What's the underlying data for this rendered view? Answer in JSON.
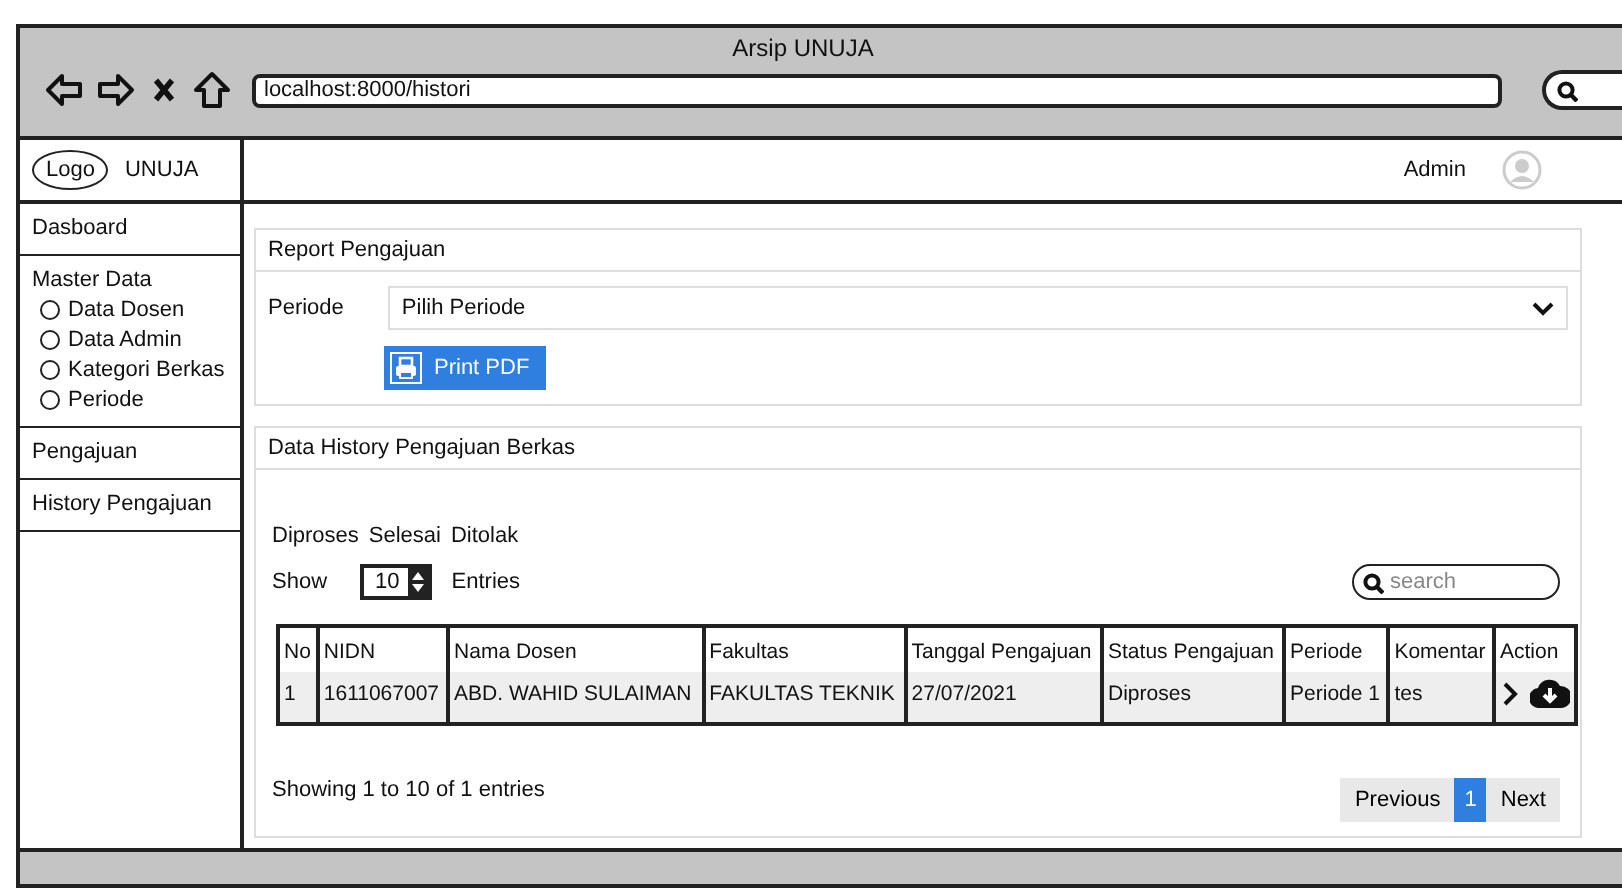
{
  "browser": {
    "title": "Arsip UNUJA",
    "url": "localhost:8000/histori"
  },
  "header": {
    "logo": "Logo",
    "brand": "UNUJA",
    "user": "Admin"
  },
  "sidebar": {
    "items": [
      {
        "label": "Dasboard"
      },
      {
        "label": "Master Data",
        "children": [
          {
            "label": "Data Dosen",
            "selected": false
          },
          {
            "label": "Data Admin",
            "selected": false
          },
          {
            "label": "Kategori Berkas",
            "selected": false
          },
          {
            "label": "Periode",
            "selected": false
          }
        ]
      },
      {
        "label": "Pengajuan"
      },
      {
        "label": "History Pengajuan"
      }
    ]
  },
  "report": {
    "title": "Report Pengajuan",
    "periode_label": "Periode",
    "periode_value": "Pilih Periode",
    "button": "Print PDF"
  },
  "history": {
    "title": "Data History Pengajuan Berkas",
    "filters": [
      "Diproses",
      "Selesai",
      "Ditolak"
    ],
    "show_label": "Show",
    "entries_value": "10",
    "entries_label": "Entries",
    "search": {
      "placeholder": "search"
    },
    "table": {
      "columns": [
        "No",
        "NIDN",
        "Nama Dosen",
        "Fakultas",
        "Tanggal Pengajuan",
        "Status Pengajuan",
        "Periode",
        "Komentar",
        "Action"
      ],
      "rows": [
        [
          "1",
          "1611067007",
          "ABD. WAHID SULAIMAN",
          "FAKULTAS TEKNIK",
          "27/07/2021",
          "Diproses",
          "Periode 1",
          "tes"
        ]
      ]
    },
    "info": "Showing 1 to 10 of 1 entries",
    "pagination": [
      {
        "label": "Previous",
        "selected": false
      },
      {
        "label": "1",
        "selected": true
      },
      {
        "label": "Next",
        "selected": false
      }
    ]
  }
}
